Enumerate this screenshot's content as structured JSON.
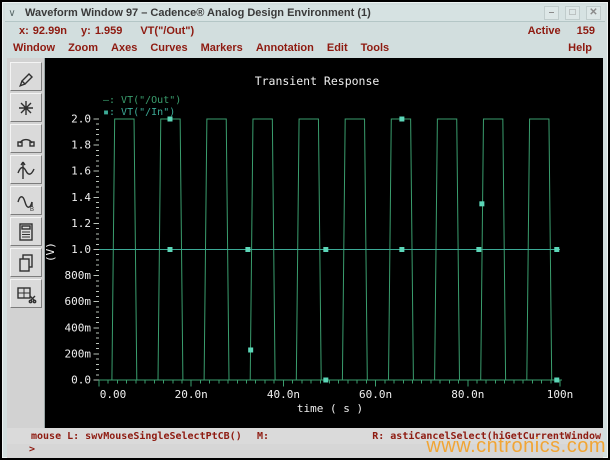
{
  "window": {
    "title": "Waveform Window 97 – Cadence® Analog Design Environment (1)",
    "chevron": "∨",
    "controls": {
      "minimize": "–",
      "maximize": "□",
      "close": "✕"
    }
  },
  "readout": {
    "x_label": "x:",
    "x_value": "92.99n",
    "y_label": "y:",
    "y_value": "1.959",
    "trace": "VT(\"/Out\")",
    "active_label": "Active",
    "active_value": "159"
  },
  "menus": [
    "Window",
    "Zoom",
    "Axes",
    "Curves",
    "Markers",
    "Annotation",
    "Edit",
    "Tools"
  ],
  "help_label": "Help",
  "toolbar": {
    "icons": [
      "stylus",
      "zoom-star",
      "arc-curve",
      "axes-wave",
      "curve-b",
      "calculator",
      "copy",
      "snip-window"
    ]
  },
  "chart_data": {
    "type": "line",
    "title": "Transient Response",
    "xlabel": "time ( s )",
    "ylabel": "(V)",
    "grid": false,
    "legend_position": "top-left-inside",
    "x_axis": {
      "min": 0,
      "max": 100,
      "unit": "ns",
      "major_step": 20,
      "minor_step": 2,
      "labels": [
        "0.00",
        "20.0n",
        "40.0n",
        "60.0n",
        "80.0n",
        "100n"
      ]
    },
    "y_axis": {
      "min": 0,
      "max": 2,
      "unit": "V",
      "major_step": 0.2,
      "minor_step": 0.04,
      "labels": [
        "0.0",
        "200m",
        "400m",
        "600m",
        "800m",
        "1.0",
        "1.2",
        "1.4",
        "1.6",
        "1.8",
        "2.0"
      ]
    },
    "series": [
      {
        "name": "VT(\"/Out\")",
        "marker": "—",
        "color": "#3a9e6e",
        "points": [
          [
            0,
            0
          ],
          [
            2.8,
            0
          ],
          [
            3.4,
            2
          ],
          [
            7.6,
            2
          ],
          [
            8.2,
            0
          ],
          [
            12.8,
            0
          ],
          [
            13.4,
            2
          ],
          [
            17.6,
            2
          ],
          [
            18.2,
            0
          ],
          [
            22.8,
            0
          ],
          [
            23.4,
            2
          ],
          [
            27.6,
            2
          ],
          [
            28.2,
            0
          ],
          [
            32.8,
            0
          ],
          [
            33.4,
            2
          ],
          [
            37.6,
            2
          ],
          [
            38.2,
            0
          ],
          [
            42.8,
            0
          ],
          [
            43.4,
            2
          ],
          [
            47.6,
            2
          ],
          [
            48.2,
            0
          ],
          [
            52.8,
            0
          ],
          [
            53.4,
            2
          ],
          [
            57.6,
            2
          ],
          [
            58.2,
            0
          ],
          [
            62.8,
            0
          ],
          [
            63.4,
            2
          ],
          [
            67.6,
            2
          ],
          [
            68.2,
            0
          ],
          [
            72.8,
            0
          ],
          [
            73.4,
            2
          ],
          [
            77.6,
            2
          ],
          [
            78.2,
            0
          ],
          [
            82.8,
            0
          ],
          [
            83.4,
            2
          ],
          [
            87.6,
            2
          ],
          [
            88.2,
            0
          ],
          [
            92.8,
            0
          ],
          [
            93.4,
            2
          ],
          [
            97.6,
            2
          ],
          [
            98.2,
            0
          ],
          [
            100,
            0
          ]
        ]
      },
      {
        "name": "VT(\"/In\")",
        "marker": "▪",
        "color": "#3caa96",
        "points": [
          [
            0,
            1
          ],
          [
            100,
            1
          ]
        ]
      }
    ],
    "selection_handles": {
      "color": "#5cd6b8",
      "on_out": [
        [
          15.4,
          2
        ],
        [
          32.9,
          0.23
        ],
        [
          49.2,
          0
        ],
        [
          65.7,
          2
        ],
        [
          83.05,
          1.35
        ],
        [
          99.3,
          0
        ]
      ],
      "on_in": [
        [
          15.4,
          1
        ],
        [
          32.3,
          1
        ],
        [
          49.2,
          1
        ],
        [
          65.7,
          1
        ],
        [
          82.4,
          1
        ],
        [
          99.3,
          1
        ]
      ]
    },
    "colors": {
      "plot_bg": "#000000",
      "text": "#efefef",
      "x_axis": "#3a9e6e",
      "y_ticks": "#b9c2b9"
    }
  },
  "status": {
    "left": "mouse L: swvMouseSingleSelectPtCB()",
    "middle": "M:",
    "right": "R: astiCancelSelect(hiGetCurrentWindow",
    "prompt": ">"
  },
  "watermark": "www.cntronics.com"
}
